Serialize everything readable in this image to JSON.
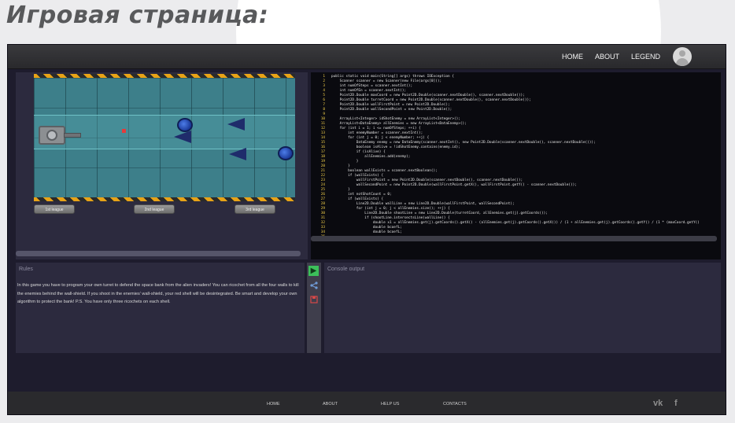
{
  "slide": {
    "title": "Игровая страница:"
  },
  "nav": {
    "home": "HOME",
    "about": "ABOUT",
    "legend": "LEGEND"
  },
  "game": {
    "leagues": [
      "1st league",
      "2nd league",
      "3rd league"
    ]
  },
  "code": {
    "lines": [
      {
        "n": "1",
        "t": "public static void main(String[] args) throws IOException {"
      },
      {
        "n": "2",
        "t": "    Scanner scanner = new Scanner(new File(args[0]));"
      },
      {
        "n": "3",
        "t": "    int numOfSteps = scanner.nextInt();"
      },
      {
        "n": "4",
        "t": "    int numOfEn = scanner.nextInt();"
      },
      {
        "n": "5",
        "t": "    Point2D.Double maxCoord = new Point2D.Double(scanner.nextDouble(), scanner.nextDouble());"
      },
      {
        "n": "6",
        "t": "    Point2D.Double turretCoord = new Point2D.Double(scanner.nextDouble(), scanner.nextDouble());"
      },
      {
        "n": "7",
        "t": "    Point2D.Double wallFirstPoint = new Point2D.Double();"
      },
      {
        "n": "8",
        "t": "    Point2D.Double wallSecondPoint = new Point2D.Double();"
      },
      {
        "n": "9",
        "t": ""
      },
      {
        "n": "10",
        "t": "    ArrayList<Integer> idShotEnemy = new ArrayList<Integer>();"
      },
      {
        "n": "11",
        "t": "    ArrayList<DataEnemy> allEnemies = new ArrayList<DataEnemy>();"
      },
      {
        "n": "12",
        "t": "    for (int i = 1; i <= numOfSteps; ++i) {"
      },
      {
        "n": "13",
        "t": "        int enemyNumber = scanner.nextInt();"
      },
      {
        "n": "14",
        "t": "        for (int j = 0; j < enemyNumber; ++j) {"
      },
      {
        "n": "15",
        "t": "            DataEnemy enemy = new DataEnemy(scanner.nextInt(), new Point2D.Double(scanner.nextDouble(), scanner.nextDouble()));"
      },
      {
        "n": "16",
        "t": "            boolean isAlive = !idShotEnemy.contains(enemy.id);"
      },
      {
        "n": "17",
        "t": "            if (isAlive) {"
      },
      {
        "n": "18",
        "t": "                allEnemies.add(enemy);"
      },
      {
        "n": "19",
        "t": "            }"
      },
      {
        "n": "20",
        "t": "        }"
      },
      {
        "n": "21",
        "t": "        boolean wallExists = scanner.nextBoolean();"
      },
      {
        "n": "22",
        "t": "        if (wallExists) {"
      },
      {
        "n": "23",
        "t": "            wallFirstPoint = new Point2D.Double(scanner.nextDouble(), scanner.nextDouble());"
      },
      {
        "n": "24",
        "t": "            wallSecondPoint = new Point2D.Double(wallFirstPoint.getX(), wallFirstPoint.getY() - scanner.nextDouble());"
      },
      {
        "n": "25",
        "t": "        }"
      },
      {
        "n": "26",
        "t": "        int notShotCount = 0;"
      },
      {
        "n": "27",
        "t": "        if (wallExists) {"
      },
      {
        "n": "28",
        "t": "            Line2D.Double wallLine = new Line2D.Double(wallFirstPoint, wallSecondPoint);"
      },
      {
        "n": "29",
        "t": "            for (int j = 0; j < allEnemies.size(); ++j) {"
      },
      {
        "n": "30",
        "t": "                Line2D.Double shootLine = new Line2D.Double(turretCoord, allEnemies.get(j).getCoords());"
      },
      {
        "n": "31",
        "t": "                if (shootLine.intersectsLine(wallLine)) {"
      },
      {
        "n": "32",
        "t": "                    double x1 = allEnemies.get(j).getCoords().getX() - (allEnemies.get(j).getCoords().getX()) / (1 + allEnemies.get(j).getCoords().getY() / (1 * (maxCoord.getY()"
      },
      {
        "n": "33",
        "t": "                    double bcoefL;"
      },
      {
        "n": "34",
        "t": "                    double bcoefL;"
      },
      {
        "n": "35",
        "t": ""
      }
    ]
  },
  "rules": {
    "title": "Rules",
    "text": "In this game you have to program your own turret to defend the space bank from the alien invaders! You can ricochet from all the four walls to kill the enemies behind the wall-shield. If you shoot in the enemies' wall-shield, your red shell will be desintegrated. Be smart and develop your own algorithm to protect the bank! P.S. You have only three ricochets on each shell."
  },
  "console": {
    "title": "Console output"
  },
  "footer": {
    "home": "HOME",
    "about": "ABOUT",
    "help": "HELP US",
    "contacts": "CONTACTS",
    "vk": "vk",
    "fb": "f"
  },
  "colors": {
    "frame_bg": "#1e1c2d",
    "panel_bg": "#2c2a3e",
    "line_numbers": "#f5d24a",
    "run_icon": "#3cc05a",
    "share_icon": "#6f9bd6",
    "save_icon": "#d84848"
  },
  "icons": [
    "avatar-icon",
    "run-icon",
    "share-icon",
    "save-icon",
    "vk-icon",
    "facebook-icon"
  ]
}
